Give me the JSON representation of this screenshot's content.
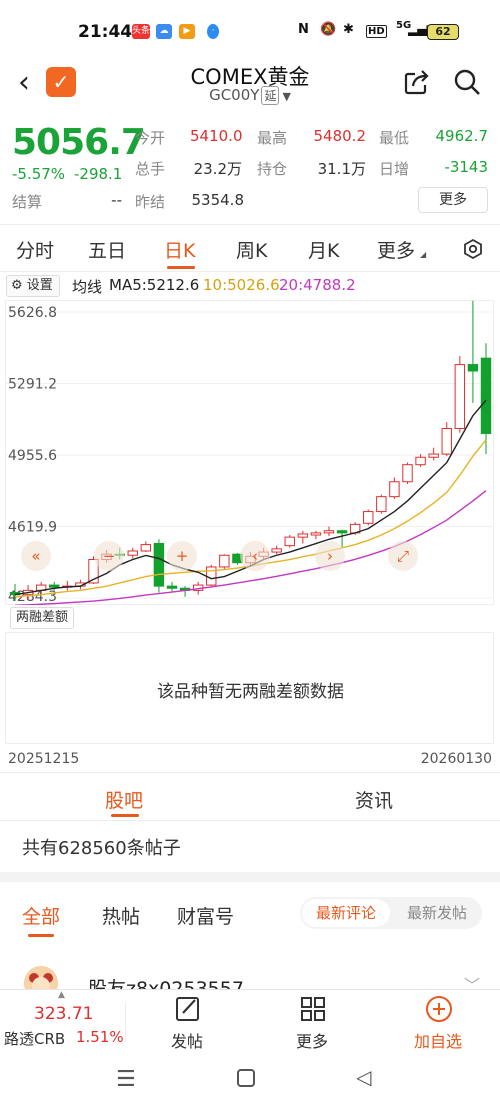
{
  "status_bar": {
    "time": "21:44",
    "battery": "62",
    "signal_label": "5G",
    "hd_label": "HD",
    "nfc_label": "N"
  },
  "header": {
    "title": "COMEX黄金",
    "code": "GC00Y",
    "tag": "延"
  },
  "quote": {
    "price": "5056.7",
    "change_pct": "-5.57%",
    "change_abs": "-298.1",
    "rows": [
      [
        {
          "label": "今开",
          "value": "5410.0",
          "color": "red"
        },
        {
          "label": "最高",
          "value": "5480.2",
          "color": "red"
        },
        {
          "label": "最低",
          "value": "4962.7",
          "color": "green"
        }
      ],
      [
        {
          "label": "总手",
          "value": "23.2万",
          "color": "dark"
        },
        {
          "label": "持仓",
          "value": "31.1万",
          "color": "dark"
        },
        {
          "label": "日增",
          "value": "-3143",
          "color": "green"
        }
      ],
      [
        {
          "label": "结算",
          "value": "--",
          "color": "dark"
        },
        {
          "label": "昨结",
          "value": "5354.8",
          "color": "dark"
        }
      ]
    ],
    "more_label": "更多"
  },
  "period_tabs": [
    "分时",
    "五日",
    "日K",
    "周K",
    "月K",
    "更多"
  ],
  "active_period": "日K",
  "indicator": {
    "settings_label": "设置",
    "ma_title": "均线",
    "ma5": "MA5:5212.6",
    "ma10": "10:5026.6",
    "ma20": "20:4788.2",
    "colors": {
      "ma5": "#222222",
      "ma10": "#e6b422",
      "ma20": "#c238c2"
    }
  },
  "chart_data": {
    "type": "candlestick",
    "y_ticks": [
      "5626.8",
      "5291.2",
      "4955.6",
      "4619.9",
      "4284.3"
    ],
    "ylim": [
      4284.3,
      5626.8
    ],
    "x_start_label": "20251215",
    "x_end_label": "20260130",
    "candles": [
      {
        "o": 4310,
        "h": 4350,
        "l": 4270,
        "c": 4300
      },
      {
        "o": 4300,
        "h": 4345,
        "l": 4275,
        "c": 4320
      },
      {
        "o": 4320,
        "h": 4360,
        "l": 4300,
        "c": 4345
      },
      {
        "o": 4345,
        "h": 4360,
        "l": 4320,
        "c": 4335
      },
      {
        "o": 4335,
        "h": 4365,
        "l": 4320,
        "c": 4340
      },
      {
        "o": 4340,
        "h": 4370,
        "l": 4325,
        "c": 4355
      },
      {
        "o": 4355,
        "h": 4480,
        "l": 4350,
        "c": 4465
      },
      {
        "o": 4465,
        "h": 4510,
        "l": 4450,
        "c": 4490
      },
      {
        "o": 4490,
        "h": 4520,
        "l": 4465,
        "c": 4485
      },
      {
        "o": 4485,
        "h": 4520,
        "l": 4470,
        "c": 4505
      },
      {
        "o": 4505,
        "h": 4550,
        "l": 4500,
        "c": 4535
      },
      {
        "o": 4540,
        "h": 4560,
        "l": 4310,
        "c": 4340
      },
      {
        "o": 4340,
        "h": 4360,
        "l": 4310,
        "c": 4330
      },
      {
        "o": 4330,
        "h": 4340,
        "l": 4290,
        "c": 4320
      },
      {
        "o": 4320,
        "h": 4360,
        "l": 4300,
        "c": 4345
      },
      {
        "o": 4345,
        "h": 4440,
        "l": 4340,
        "c": 4430
      },
      {
        "o": 4430,
        "h": 4490,
        "l": 4420,
        "c": 4485
      },
      {
        "o": 4490,
        "h": 4495,
        "l": 4440,
        "c": 4450
      },
      {
        "o": 4450,
        "h": 4500,
        "l": 4430,
        "c": 4480
      },
      {
        "o": 4480,
        "h": 4520,
        "l": 4460,
        "c": 4500
      },
      {
        "o": 4500,
        "h": 4530,
        "l": 4490,
        "c": 4515
      },
      {
        "o": 4530,
        "h": 4580,
        "l": 4520,
        "c": 4570
      },
      {
        "o": 4570,
        "h": 4600,
        "l": 4540,
        "c": 4585
      },
      {
        "o": 4580,
        "h": 4600,
        "l": 4560,
        "c": 4590
      },
      {
        "o": 4590,
        "h": 4620,
        "l": 4575,
        "c": 4600
      },
      {
        "o": 4600,
        "h": 4605,
        "l": 4520,
        "c": 4590
      },
      {
        "o": 4590,
        "h": 4640,
        "l": 4580,
        "c": 4630
      },
      {
        "o": 4635,
        "h": 4700,
        "l": 4625,
        "c": 4690
      },
      {
        "o": 4690,
        "h": 4770,
        "l": 4680,
        "c": 4760
      },
      {
        "o": 4760,
        "h": 4850,
        "l": 4750,
        "c": 4830
      },
      {
        "o": 4830,
        "h": 4920,
        "l": 4820,
        "c": 4910
      },
      {
        "o": 4910,
        "h": 4960,
        "l": 4900,
        "c": 4945
      },
      {
        "o": 4945,
        "h": 4990,
        "l": 4930,
        "c": 4960
      },
      {
        "o": 4960,
        "h": 5110,
        "l": 4950,
        "c": 5080
      },
      {
        "o": 5080,
        "h": 5420,
        "l": 5060,
        "c": 5380
      },
      {
        "o": 5380,
        "h": 5680,
        "l": 5200,
        "c": 5350
      },
      {
        "o": 5410,
        "h": 5480,
        "l": 4960,
        "c": 5056.7
      }
    ],
    "ma5": [
      4300,
      4310,
      4320,
      4330,
      4336,
      4340,
      4372,
      4400,
      4440,
      4465,
      4484,
      4470,
      4440,
      4420,
      4405,
      4375,
      4385,
      4410,
      4435,
      4465,
      4485,
      4500,
      4520,
      4540,
      4560,
      4575,
      4590,
      4610,
      4650,
      4690,
      4740,
      4800,
      4860,
      4920,
      5030,
      5140,
      5212.6
    ],
    "ma10": [
      4290,
      4295,
      4300,
      4308,
      4315,
      4320,
      4330,
      4340,
      4355,
      4370,
      4385,
      4395,
      4400,
      4405,
      4410,
      4412,
      4418,
      4425,
      4435,
      4445,
      4455,
      4465,
      4478,
      4490,
      4505,
      4520,
      4535,
      4555,
      4580,
      4610,
      4645,
      4685,
      4730,
      4780,
      4860,
      4950,
      5026.6
    ],
    "ma20": [
      4250,
      4252,
      4255,
      4258,
      4262,
      4266,
      4270,
      4276,
      4282,
      4290,
      4298,
      4305,
      4312,
      4320,
      4328,
      4336,
      4345,
      4355,
      4365,
      4375,
      4386,
      4398,
      4410,
      4422,
      4436,
      4450,
      4466,
      4484,
      4504,
      4526,
      4552,
      4582,
      4615,
      4650,
      4695,
      4740,
      4788.2
    ]
  },
  "margin_panel": {
    "label": "两融差额",
    "empty_message": "该品种暂无两融差额数据"
  },
  "main_tabs": [
    "股吧",
    "资讯"
  ],
  "active_main_tab": "股吧",
  "post_count": "共有628560条帖子",
  "filter_tabs": [
    "全部",
    "热帖",
    "财富号"
  ],
  "sort_options": [
    "最新评论",
    "最新发帖"
  ],
  "first_post": {
    "author": "股友z8x0253557"
  },
  "bottom_bar": {
    "index_value": "323.71",
    "index_name": "路透CRB",
    "index_pct": "1.51%",
    "post_label": "发帖",
    "more_label": "更多",
    "add_label": "加自选"
  }
}
